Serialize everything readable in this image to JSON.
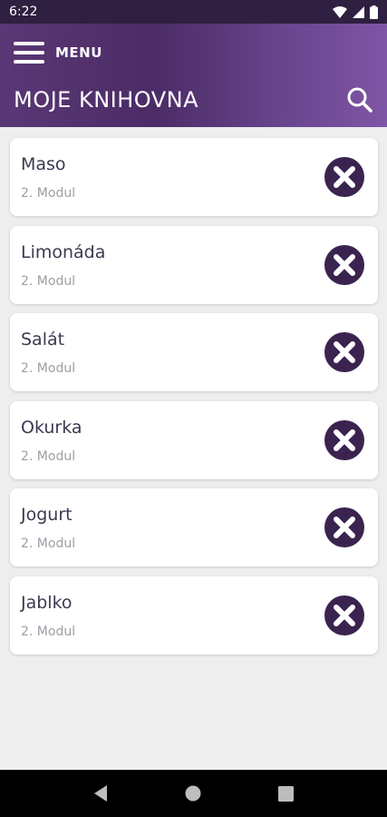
{
  "status_bar": {
    "time": "6:22"
  },
  "header": {
    "menu_label": "MENU",
    "title": "MOJE KNIHOVNA"
  },
  "items": [
    {
      "title": "Maso",
      "subtitle": "2. Modul"
    },
    {
      "title": "Limonáda",
      "subtitle": "2. Modul"
    },
    {
      "title": "Salát",
      "subtitle": "2. Modul"
    },
    {
      "title": "Okurka",
      "subtitle": "2. Modul"
    },
    {
      "title": "Jogurt",
      "subtitle": "2. Modul"
    },
    {
      "title": "Jablko",
      "subtitle": "2. Modul"
    }
  ],
  "icons": {
    "menu": "hamburger-icon",
    "search": "search-icon",
    "remove": "close-circle-icon",
    "nav_back": "back-triangle-icon",
    "nav_home": "home-circle-icon",
    "nav_recents": "recents-square-icon"
  },
  "colors": {
    "header_start": "#5a3775",
    "header_end": "#7f55a5",
    "status_bar": "#2f1f40",
    "remove_icon": "#3b2350",
    "background": "#eeeeee"
  }
}
